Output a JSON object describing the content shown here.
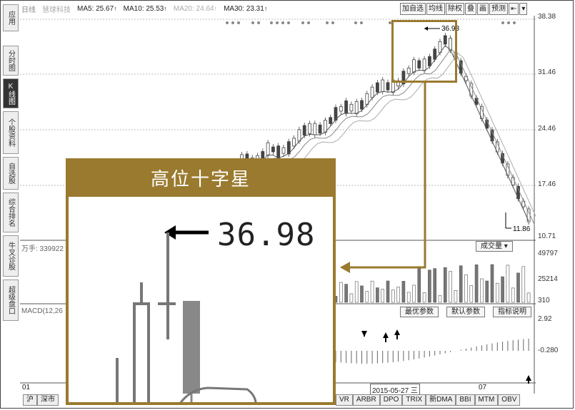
{
  "left_tabs": [
    {
      "label": "应用",
      "active": false
    },
    {
      "label": "分时图",
      "active": false
    },
    {
      "label": "K线图",
      "active": true
    },
    {
      "label": "个股资料",
      "active": false
    },
    {
      "label": "自选股",
      "active": false
    },
    {
      "label": "综合排名",
      "active": false
    },
    {
      "label": "牛叉诊股",
      "active": false
    },
    {
      "label": "超级盘口",
      "active": false
    }
  ],
  "header": {
    "stock_name": "日线",
    "stock_sub": "慧球科技",
    "ma5": "MA5: 25.67",
    "ma10": "MA10: 25.53",
    "ma20": "MA20: 24.64",
    "ma30": "MA30: 23.31",
    "up_arrow": "↑"
  },
  "toolbar": [
    "加自选",
    "均线",
    "除权",
    "叠",
    "画",
    "预测",
    "⇤",
    "▾"
  ],
  "price_axis": [
    "38.38",
    "31.46",
    "24.46",
    "17.46",
    "10.71"
  ],
  "volume_axis": [
    "49797",
    "25214",
    "310"
  ],
  "macd_axis": [
    "2.92",
    "-0.280"
  ],
  "annotations": {
    "high": "36.98",
    "low": "11.86",
    "volume_label": "成交量",
    "volume_prefix": "万手: 339922",
    "macd_label": "MACD(12,26",
    "date_left": "01",
    "date_mid": "2015-05-27 三",
    "date_right": "07"
  },
  "sub_buttons": [
    "最优参数",
    "默认参数",
    "指标说明"
  ],
  "bottom_tabs": [
    "VR",
    "ARBR",
    "DPO",
    "TRIX",
    "新DMA",
    "BBI",
    "MTM",
    "OBV"
  ],
  "bottom_left_tabs": [
    "沪",
    "深市"
  ],
  "callout": {
    "title": "高位十字星",
    "value": "36.98"
  },
  "colors": {
    "accent": "#9a7a2f",
    "candle": "#333333"
  }
}
